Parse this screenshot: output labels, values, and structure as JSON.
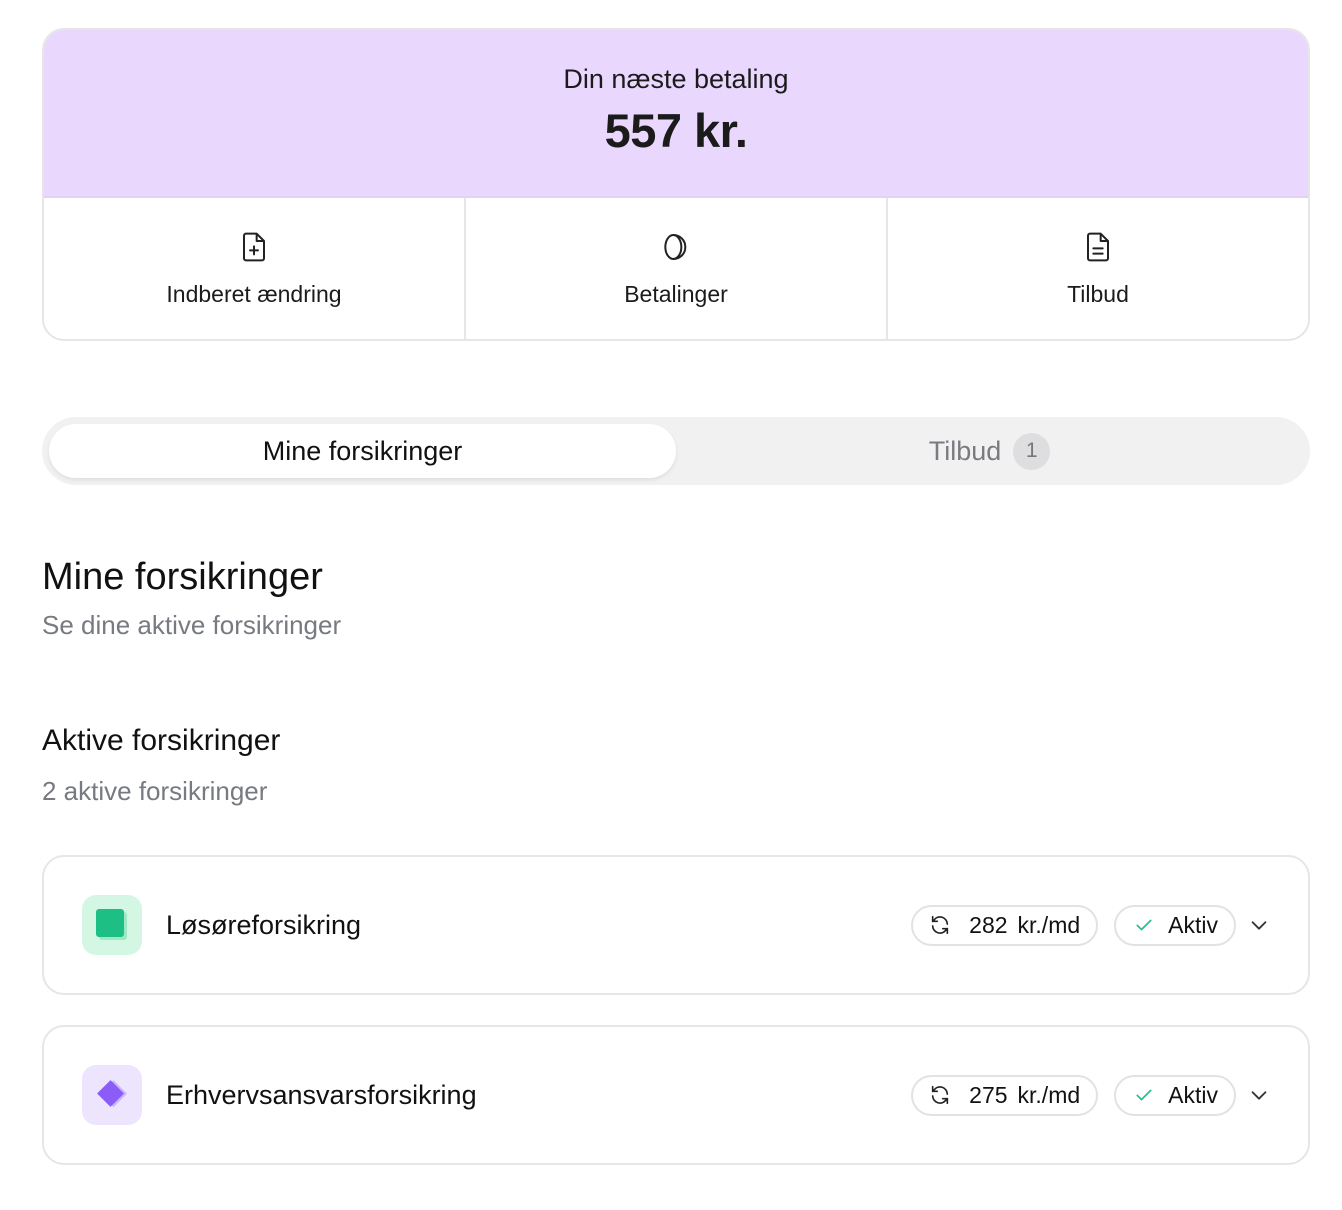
{
  "payment": {
    "label": "Din næste betaling",
    "amount": "557 kr."
  },
  "actions": [
    {
      "label": "Indberet ændring",
      "icon": "file-plus-icon"
    },
    {
      "label": "Betalinger",
      "icon": "coins-icon"
    },
    {
      "label": "Tilbud",
      "icon": "file-text-icon"
    }
  ],
  "tabs": [
    {
      "label": "Mine forsikringer",
      "active": true
    },
    {
      "label": "Tilbud",
      "badge": "1",
      "active": false
    }
  ],
  "section": {
    "title": "Mine forsikringer",
    "subtitle": "Se dine aktive forsikringer"
  },
  "active": {
    "title": "Aktive forsikringer",
    "subtitle": "2 aktive forsikringer"
  },
  "policies": [
    {
      "name": "Løsøreforsikring",
      "price": "282",
      "unit": "kr./md",
      "status": "Aktiv",
      "icon": "green-square-icon",
      "icon_bg": "#d4f7e4",
      "icon_color": "#1dbf84"
    },
    {
      "name": "Erhvervsansvarsforsikring",
      "price": "275",
      "unit": "kr./md",
      "status": "Aktiv",
      "icon": "purple-diamond-icon",
      "icon_bg": "#ece5fd",
      "icon_color": "#8b5cf6"
    }
  ]
}
